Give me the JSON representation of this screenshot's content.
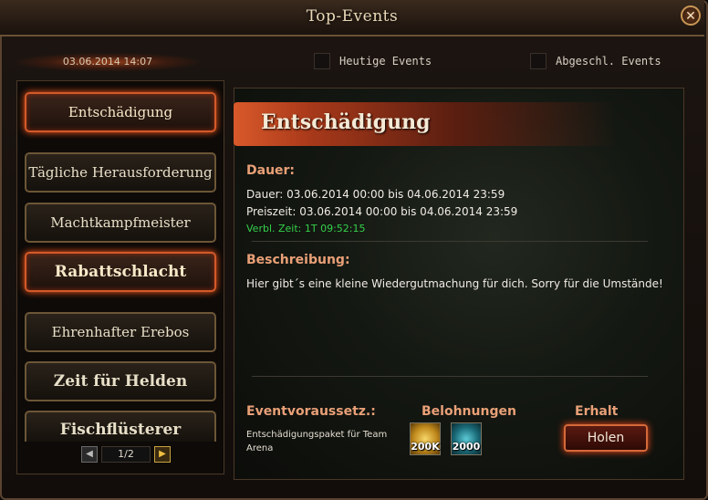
{
  "window": {
    "title": "Top-Events",
    "close_symbol": "✕"
  },
  "header": {
    "datetime": "03.06.2014 14:07"
  },
  "filters": [
    {
      "label": "Heutige Events",
      "checked": false
    },
    {
      "label": "Abgeschl. Events",
      "checked": false
    }
  ],
  "sidebar": {
    "items": [
      {
        "label": "Entschädigung",
        "active": true
      },
      {
        "label": "Tägliche Herausforderung",
        "active": false
      },
      {
        "label": "Machtkampfmeister",
        "active": false
      },
      {
        "label": "Rabattschlacht",
        "active": true
      },
      {
        "label": "Ehrenhafter Erebos",
        "active": false
      },
      {
        "label": "Zeit für Helden",
        "active": false
      },
      {
        "label": "Fischflüsterer",
        "active": false
      }
    ],
    "pager": {
      "prev_symbol": "◀",
      "page": "1/2",
      "next_symbol": "▶"
    }
  },
  "event": {
    "title": "Entschädigung",
    "duration_heading": "Dauer:",
    "duration": "Dauer: 03.06.2014 00:00 bis 04.06.2014 23:59",
    "prize_time": "Preiszeit: 03.06.2014 00:00 bis 04.06.2014 23:59",
    "remaining": "Verbl. Zeit: 1T 09:52:15",
    "description_heading": "Beschreibung:",
    "description": "Hier gibt´s eine kleine Wiedergutmachung für dich. Sorry für die Umstände!",
    "requirements_heading": "Eventvoraussetz.:",
    "requirements_text": "Entschädigungspaket für Team Arena",
    "rewards_heading": "Belohnungen",
    "rewards": [
      {
        "icon": "gold-coins-icon",
        "amount": "200K"
      },
      {
        "icon": "gem-crystal-icon",
        "amount": "2000"
      }
    ],
    "claim_heading": "Erhalt",
    "claim_button": "Holen"
  }
}
